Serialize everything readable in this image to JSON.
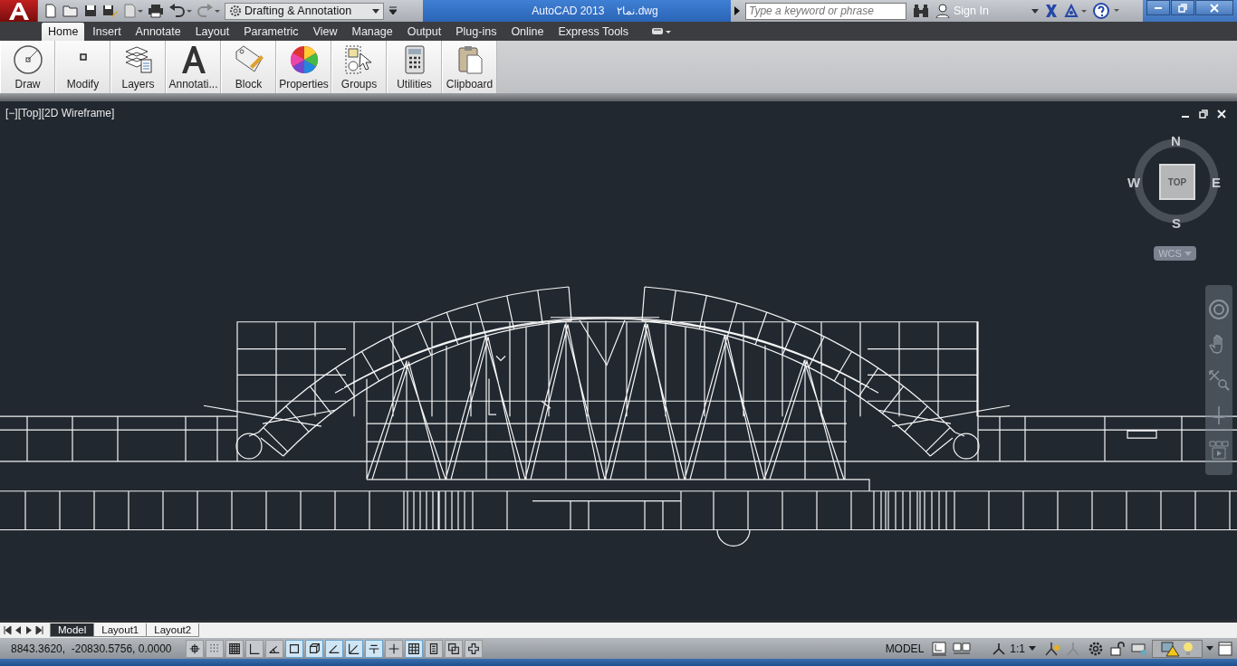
{
  "title_bar": {
    "workspace": "Drafting & Annotation",
    "app_name": "AutoCAD 2013",
    "file_name": "نما۲.dwg",
    "search": {
      "placeholder": "Type a keyword or phrase"
    },
    "sign_in": "Sign In"
  },
  "ribbon_tabs": [
    {
      "label": "Home",
      "selected": true
    },
    {
      "label": "Insert",
      "selected": false
    },
    {
      "label": "Annotate",
      "selected": false
    },
    {
      "label": "Layout",
      "selected": false
    },
    {
      "label": "Parametric",
      "selected": false
    },
    {
      "label": "View",
      "selected": false
    },
    {
      "label": "Manage",
      "selected": false
    },
    {
      "label": "Output",
      "selected": false
    },
    {
      "label": "Plug-ins",
      "selected": false
    },
    {
      "label": "Online",
      "selected": false
    },
    {
      "label": "Express Tools",
      "selected": false
    }
  ],
  "ribbon_panels": [
    {
      "label": "Draw",
      "kind": "draw"
    },
    {
      "label": "Modify",
      "kind": "modify"
    },
    {
      "label": "Layers",
      "kind": "layers"
    },
    {
      "label": "Annotati...",
      "kind": "annotation"
    },
    {
      "label": "Block",
      "kind": "block"
    },
    {
      "label": "Properties",
      "kind": "properties"
    },
    {
      "label": "Groups",
      "kind": "groups"
    },
    {
      "label": "Utilities",
      "kind": "utilities"
    },
    {
      "label": "Clipboard",
      "kind": "clipboard"
    }
  ],
  "viewport": {
    "label": "[−][Top][2D Wireframe]",
    "viewcube": {
      "north": "N",
      "south": "S",
      "east": "E",
      "west": "W",
      "face": "TOP",
      "ucs": "WCS"
    }
  },
  "layout_tabs": [
    {
      "label": "Model",
      "selected": true
    },
    {
      "label": "Layout1",
      "selected": false
    },
    {
      "label": "Layout2",
      "selected": false
    }
  ],
  "status_bar": {
    "coordinates": "8843.3620,  -20830.5756, 0.0000",
    "toggles": [
      {
        "kind": "infer",
        "on": false
      },
      {
        "kind": "snap",
        "on": false
      },
      {
        "kind": "grid",
        "on": false
      },
      {
        "kind": "ortho",
        "on": false
      },
      {
        "kind": "polar",
        "on": false
      },
      {
        "kind": "osnap",
        "on": true
      },
      {
        "kind": "osnap3d",
        "on": true
      },
      {
        "kind": "otrack",
        "on": true
      },
      {
        "kind": "ducs",
        "on": true
      },
      {
        "kind": "dyn",
        "on": true
      },
      {
        "kind": "lineweight",
        "on": false
      },
      {
        "kind": "transparency",
        "on": true
      },
      {
        "kind": "quickprops",
        "on": false
      },
      {
        "kind": "cycling",
        "on": false
      },
      {
        "kind": "monitor",
        "on": false
      }
    ],
    "space": "MODEL",
    "scale": "1:1"
  }
}
